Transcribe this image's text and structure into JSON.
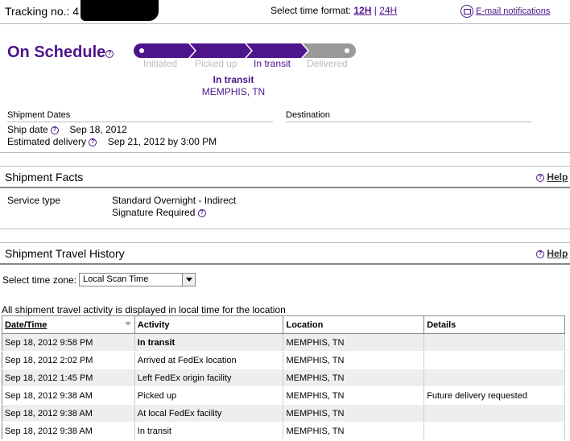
{
  "header": {
    "tracking_label": "Tracking no.: 4",
    "time_format_label": "Select time format:",
    "time_format_12h": "12H",
    "time_format_sep": "|",
    "time_format_24h": "24H",
    "email_notifications": "E-mail notifications"
  },
  "status": {
    "title": "On Schedule",
    "stages": [
      "Initiated",
      "Picked up",
      "In transit",
      "Delivered"
    ],
    "current_stage_index": 2,
    "current_status": "In transit",
    "current_location": "MEMPHIS, TN",
    "colors": {
      "brand_purple": "#4d148c",
      "inactive_gray": "#999999"
    }
  },
  "dates": {
    "section_label": "Shipment Dates",
    "destination_label": "Destination",
    "ship_date_label": "Ship date",
    "ship_date_value": "Sep 18, 2012",
    "est_delivery_label": "Estimated delivery",
    "est_delivery_value": "Sep 21, 2012 by 3:00 PM"
  },
  "facts": {
    "title": "Shipment Facts",
    "help": "Help",
    "service_type_label": "Service type",
    "service_type_value": "Standard Overnight - Indirect",
    "signature_value": "Signature Required"
  },
  "history": {
    "title": "Shipment Travel History",
    "help": "Help",
    "timezone_label": "Select time zone:",
    "timezone_value": "Local Scan Time",
    "note": "All shipment travel activity is displayed in local time for the location",
    "columns": [
      "Date/Time",
      "Activity",
      "Location",
      "Details"
    ],
    "rows": [
      {
        "datetime": "Sep 18, 2012 9:58 PM",
        "activity": "In transit",
        "location": "MEMPHIS, TN",
        "details": ""
      },
      {
        "datetime": "Sep 18, 2012 2:02 PM",
        "activity": "Arrived at FedEx location",
        "location": "MEMPHIS, TN",
        "details": ""
      },
      {
        "datetime": "Sep 18, 2012 1:45 PM",
        "activity": "Left FedEx origin facility",
        "location": "MEMPHIS, TN",
        "details": ""
      },
      {
        "datetime": "Sep 18, 2012 9:38 AM",
        "activity": "Picked up",
        "location": "MEMPHIS, TN",
        "details": "Future delivery requested"
      },
      {
        "datetime": "Sep 18, 2012 9:38 AM",
        "activity": "At local FedEx facility",
        "location": "MEMPHIS, TN",
        "details": ""
      },
      {
        "datetime": "Sep 18, 2012 9:38 AM",
        "activity": "In transit",
        "location": "MEMPHIS, TN",
        "details": ""
      }
    ]
  }
}
